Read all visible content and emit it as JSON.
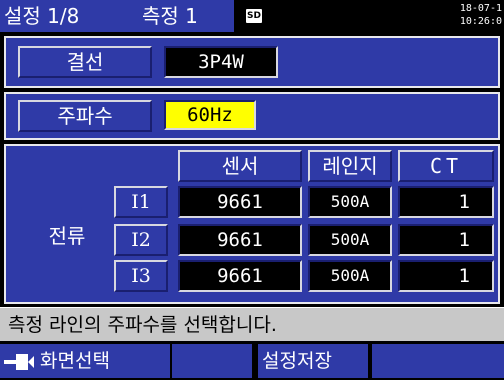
{
  "header": {
    "tab_settings": "설정 1/8",
    "tab_measure": "측정 1",
    "sd_icon_text": "SD",
    "date": "18-07-1",
    "time": "10:26:0"
  },
  "wiring": {
    "label": "결선",
    "value": "3P4W"
  },
  "frequency": {
    "label": "주파수",
    "value": "60Hz"
  },
  "current": {
    "label": "전류",
    "columns": {
      "sensor": "센서",
      "range": "레인지",
      "ct": "CT"
    },
    "rows": [
      {
        "name": "I1",
        "sensor": "9661",
        "range": "500A",
        "ct": "1"
      },
      {
        "name": "I2",
        "sensor": "9661",
        "range": "500A",
        "ct": "1"
      },
      {
        "name": "I3",
        "sensor": "9661",
        "range": "500A",
        "ct": "1"
      }
    ]
  },
  "message": "측정 라인의 주파수를 선택합니다.",
  "function_keys": {
    "f1_icon": "arrow-enter-icon",
    "f1": "화면선택",
    "f2": "",
    "f3": "설정저장",
    "f4": ""
  },
  "colors": {
    "panel": "#2f3aa7",
    "selected": "#ffff00",
    "message_bar": "#c8c8c8"
  }
}
